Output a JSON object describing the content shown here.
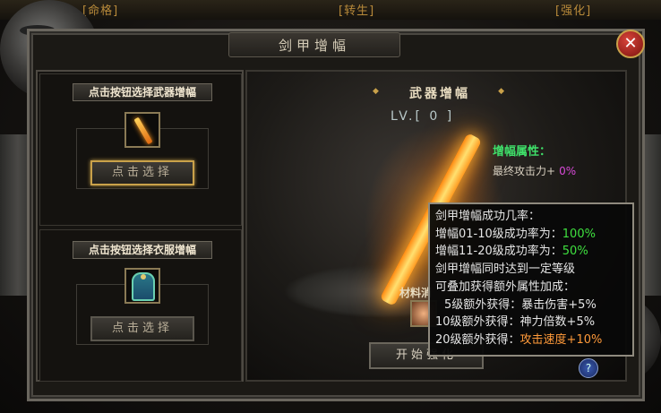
{
  "top_tabs": [
    "[命格]",
    "[转生]",
    "[强化]"
  ],
  "window": {
    "title": "剑甲增幅",
    "close_label": "✕"
  },
  "left": {
    "weapon": {
      "header": "点击按钮选择武器增幅",
      "button": "点击选择"
    },
    "armor": {
      "header": "点击按钮选择衣服增幅",
      "button": "点击选择"
    }
  },
  "main": {
    "section_title": "武器增幅",
    "level": "LV.[ 0 ]",
    "attr_title": "增幅属性：",
    "attr_label": "最终攻击力+",
    "attr_value": "0%",
    "material_label": "材料消",
    "start_button": "开始强化",
    "help_icon": "?"
  },
  "tooltip": {
    "title": "剑甲增幅成功几率：",
    "rate1_label": "增幅01-10级成功率为：",
    "rate1_value": "100%",
    "rate2_label": "增幅11-20级成功率为：",
    "rate2_value": "50%",
    "note1": "剑甲增幅同时达到一定等级",
    "note2": "可叠加获得额外属性加成：",
    "bonus5_label": "5级额外获得：",
    "bonus5_value": "暴击伤害+5%",
    "bonus10_label": "10级额外获得：",
    "bonus10_value": "神力倍数+5%",
    "bonus20_label": "20级额外获得：",
    "bonus20_value": "攻击速度+10%"
  },
  "colors": {
    "green": "#3fe03f",
    "orange": "#ff9a3a",
    "magenta": "#d84ad8",
    "gold_border": "#c9a14a"
  }
}
